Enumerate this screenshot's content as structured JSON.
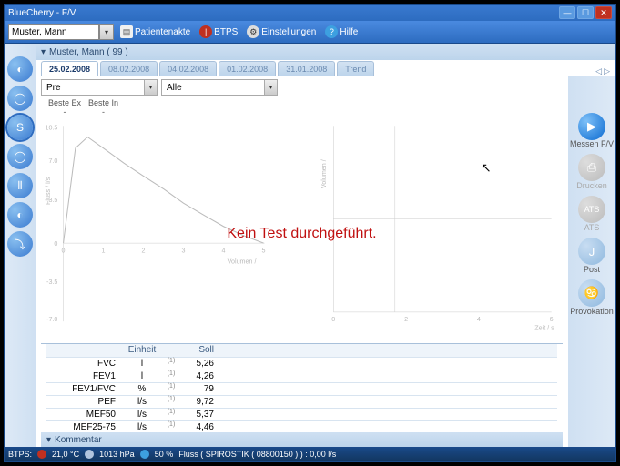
{
  "window": {
    "title": "BlueCherry - F/V"
  },
  "toolbar": {
    "patient_value": "Muster, Mann",
    "items": {
      "akte": "Patientenakte",
      "btps": "BTPS",
      "settings": "Einstellungen",
      "help": "Hilfe"
    }
  },
  "patientbar": {
    "name": "Muster, Mann ( 99 )"
  },
  "tabs": [
    "25.02.2008",
    "08.02.2008",
    "04.02.2008",
    "01.02.2008",
    "31.01.2008",
    "Trend"
  ],
  "sel": {
    "sel1_value": "Pre",
    "sel2_value": "Alle"
  },
  "best": {
    "ex": "Beste Ex",
    "in": "Beste In"
  },
  "notest": "Kein Test durchgeführt.",
  "axes": {
    "left_label": "Fluss / l/s",
    "left_xlabel": "Volumen / l",
    "right_label": "Volumen / l",
    "right_xlabel": "Zeit / s"
  },
  "table": {
    "headers": {
      "unit": "Einheit",
      "soll": "Soll"
    },
    "rows": [
      {
        "param": "FVC",
        "unit": "l",
        "fn": "(1)",
        "soll": "5,26"
      },
      {
        "param": "FEV1",
        "unit": "l",
        "fn": "(1)",
        "soll": "4,26"
      },
      {
        "param": "FEV1/FVC",
        "unit": "%",
        "fn": "(1)",
        "soll": "79"
      },
      {
        "param": "PEF",
        "unit": "l/s",
        "fn": "(1)",
        "soll": "9,72"
      },
      {
        "param": "MEF50",
        "unit": "l/s",
        "fn": "(1)",
        "soll": "5,37"
      },
      {
        "param": "MEF25-75",
        "unit": "l/s",
        "fn": "(1)",
        "soll": "4,46"
      }
    ]
  },
  "kommentar": {
    "label": "Kommentar"
  },
  "rightnav": {
    "messen": "Messen F/V",
    "drucken": "Drucken",
    "ats": "ATS",
    "post": "Post",
    "provokation": "Provokation"
  },
  "status": {
    "btps_label": "BTPS:",
    "temp": "21,0 °C",
    "press": "1013 hPa",
    "humid": "50 %",
    "flow": "Fluss ( SPIROSTIK ( 08800150 ) ) :   0,00 l/s"
  },
  "chart_data": [
    {
      "type": "line",
      "title": "",
      "xlabel": "Volumen / l",
      "ylabel": "Fluss / l/s",
      "xlim": [
        0,
        6
      ],
      "ylim": [
        -7,
        10.5
      ],
      "grid": true,
      "series": [
        {
          "name": "flow-volume",
          "x": [
            0,
            0.3,
            0.6,
            1.0,
            1.5,
            2.0,
            2.5,
            3.0,
            3.5,
            4.0,
            4.5,
            5.0
          ],
          "values": [
            0,
            8.5,
            9.5,
            8.5,
            7.2,
            6.0,
            4.8,
            3.6,
            2.5,
            1.5,
            0.6,
            0
          ]
        }
      ]
    },
    {
      "type": "line",
      "title": "",
      "xlabel": "Zeit / s",
      "ylabel": "Volumen / l",
      "xlim": [
        0,
        6
      ],
      "ylim": [
        0,
        6
      ],
      "grid": true,
      "series": []
    }
  ]
}
